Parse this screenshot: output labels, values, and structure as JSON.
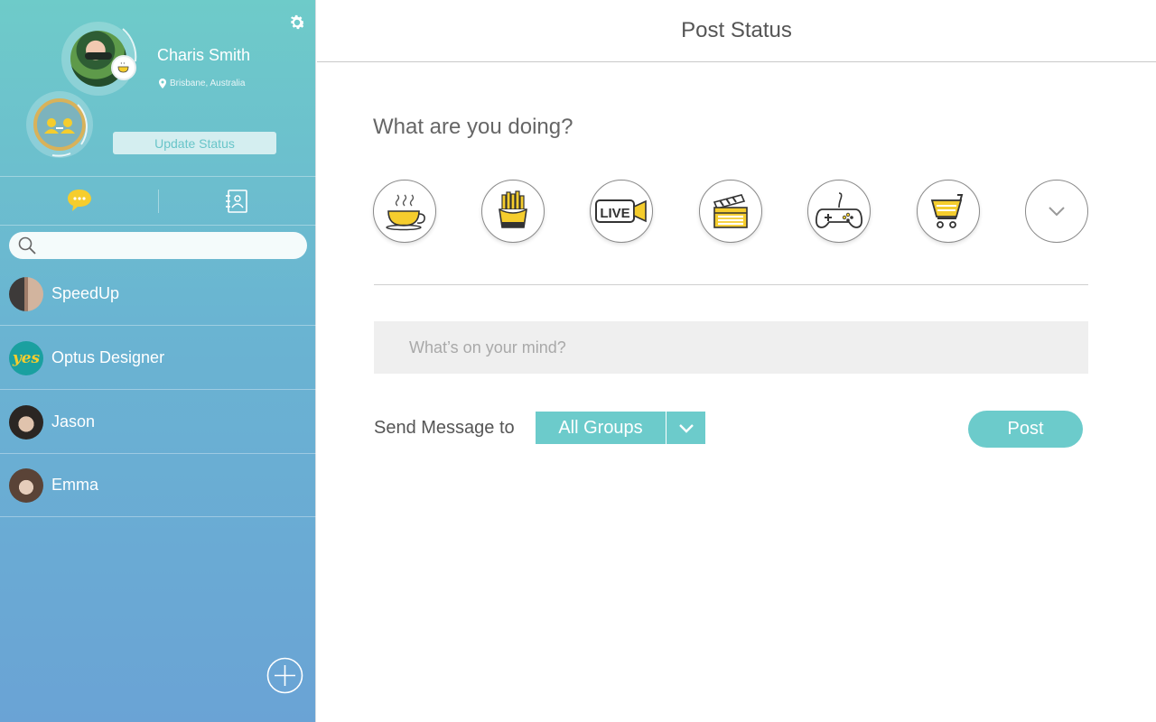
{
  "sidebar": {
    "profile": {
      "name": "Charis Smith",
      "location": "Brisbane, Australia",
      "update_status_label": "Update Status"
    },
    "search": {
      "placeholder": "",
      "value": ""
    },
    "contacts": [
      {
        "name": "SpeedUp"
      },
      {
        "name": "Optus Designer",
        "avatar_text": "yes"
      },
      {
        "name": "Jason"
      },
      {
        "name": "Emma"
      }
    ]
  },
  "main": {
    "title": "Post Status",
    "question": "What are you doing?",
    "activities": [
      {
        "icon": "coffee-cup-icon"
      },
      {
        "icon": "fries-icon"
      },
      {
        "icon": "live-camera-icon",
        "label": "LIVE"
      },
      {
        "icon": "clapperboard-icon"
      },
      {
        "icon": "game-controller-icon"
      },
      {
        "icon": "shopping-cart-icon"
      },
      {
        "icon": "chevron-down-icon"
      }
    ],
    "mind_placeholder": "What’s on your mind?",
    "send_label": "Send Message to",
    "group_selected": "All Groups",
    "post_label": "Post"
  },
  "colors": {
    "accent": "#6ccbcb",
    "icon_yellow": "#f5cd2d",
    "sidebar_top": "#6ecbc9",
    "sidebar_bottom": "#6aa3d5"
  }
}
